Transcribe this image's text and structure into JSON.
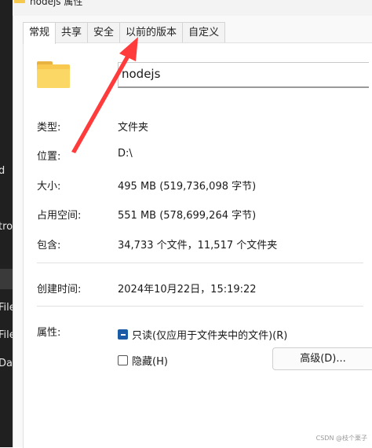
{
  "window": {
    "title": "nodejs 属性"
  },
  "background_window": {
    "fragments": [
      "d",
      "tro",
      "File",
      "File",
      "Dat"
    ]
  },
  "tabs": [
    {
      "label": "常规",
      "active": true
    },
    {
      "label": "共享",
      "active": false
    },
    {
      "label": "安全",
      "active": false
    },
    {
      "label": "以前的版本",
      "active": false
    },
    {
      "label": "自定义",
      "active": false
    }
  ],
  "folder": {
    "name": "nodejs"
  },
  "properties": {
    "type_label": "类型:",
    "type_value": "文件夹",
    "location_label": "位置:",
    "location_value": "D:\\",
    "size_label": "大小:",
    "size_value": "495 MB (519,736,098 字节)",
    "size_on_disk_label": "占用空间:",
    "size_on_disk_value": "551 MB (578,699,264 字节)",
    "contains_label": "包含:",
    "contains_value": "34,733 个文件，11,517 个文件夹",
    "created_label": "创建时间:",
    "created_value": "2024年10月22日，15:19:22",
    "attributes_label": "属性:",
    "readonly_label": "只读(仅应用于文件夹中的文件)(R)",
    "readonly_checked": true,
    "hidden_label": "隐藏(H)",
    "hidden_checked": false,
    "advanced_button": "高级(D)..."
  },
  "annotation": {
    "arrow_color": "#ff3b3b"
  },
  "watermark": "CSDN @枝个栗子"
}
